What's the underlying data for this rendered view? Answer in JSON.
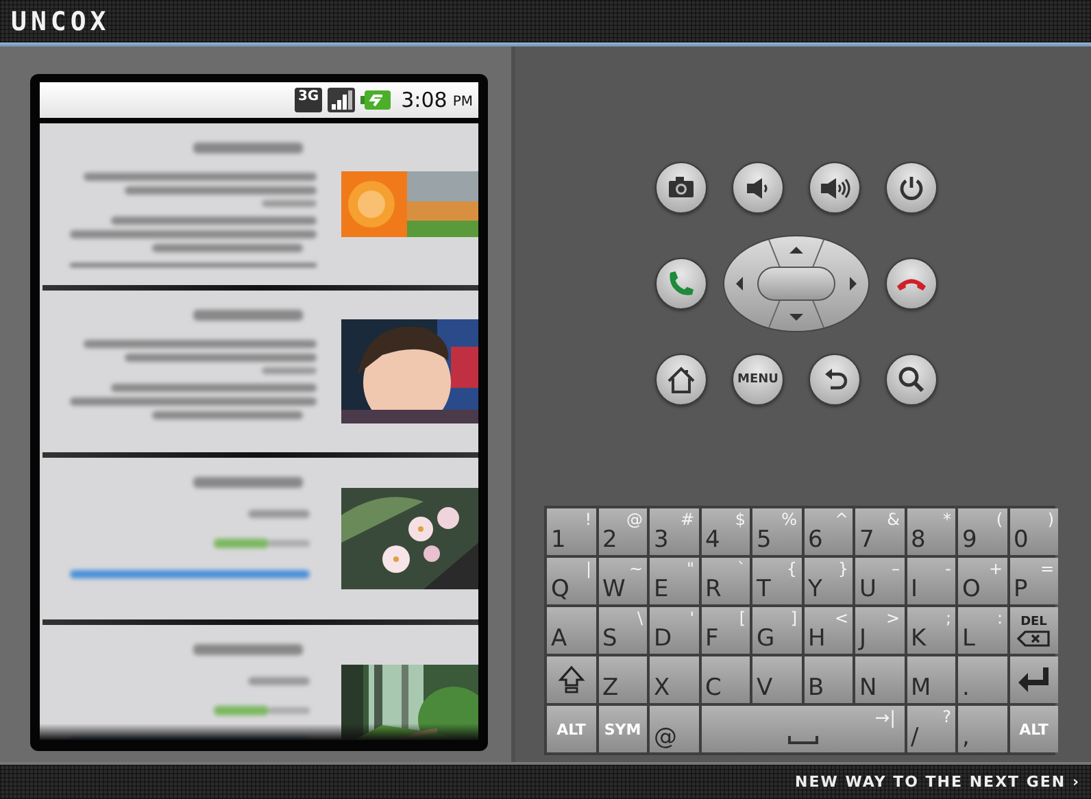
{
  "header": {
    "logo": "UNCOX"
  },
  "phone": {
    "status_bar": {
      "network": "3G",
      "time": "3:08",
      "meridiem": "PM"
    },
    "list_items": [
      {
        "kind": "long"
      },
      {
        "kind": "long"
      },
      {
        "kind": "short"
      },
      {
        "kind": "short"
      }
    ]
  },
  "controls": [
    {
      "kind": "camera"
    },
    {
      "kind": "volume-down"
    },
    {
      "kind": "volume-up"
    },
    {
      "kind": "power"
    },
    {
      "kind": "call"
    },
    {
      "kind": "dpad"
    },
    {
      "kind": "end-call"
    },
    {
      "kind": "home"
    },
    {
      "kind": "menu",
      "label": "MENU"
    },
    {
      "kind": "back"
    },
    {
      "kind": "search"
    }
  ],
  "keyboard": {
    "keys": [
      {
        "kind": "char",
        "main": "1",
        "alt": "!"
      },
      {
        "kind": "char",
        "main": "2",
        "alt": "@"
      },
      {
        "kind": "char",
        "main": "3",
        "alt": "#"
      },
      {
        "kind": "char",
        "main": "4",
        "alt": "$"
      },
      {
        "kind": "char",
        "main": "5",
        "alt": "%"
      },
      {
        "kind": "char",
        "main": "6",
        "alt": "^"
      },
      {
        "kind": "char",
        "main": "7",
        "alt": "&"
      },
      {
        "kind": "char",
        "main": "8",
        "alt": "*"
      },
      {
        "kind": "char",
        "main": "9",
        "alt": "("
      },
      {
        "kind": "char",
        "main": "0",
        "alt": ")"
      },
      {
        "kind": "char",
        "main": "Q",
        "alt": "|"
      },
      {
        "kind": "char",
        "main": "W",
        "alt": "~"
      },
      {
        "kind": "char",
        "main": "E",
        "alt": "\""
      },
      {
        "kind": "char",
        "main": "R",
        "alt": "`"
      },
      {
        "kind": "char",
        "main": "T",
        "alt": "{"
      },
      {
        "kind": "char",
        "main": "Y",
        "alt": "}"
      },
      {
        "kind": "char",
        "main": "U",
        "alt": "–"
      },
      {
        "kind": "char",
        "main": "I",
        "alt": "-"
      },
      {
        "kind": "char",
        "main": "O",
        "alt": "+"
      },
      {
        "kind": "char",
        "main": "P",
        "alt": "="
      },
      {
        "kind": "char",
        "main": "A"
      },
      {
        "kind": "char",
        "main": "S",
        "alt": "\\"
      },
      {
        "kind": "char",
        "main": "D",
        "alt": "'"
      },
      {
        "kind": "char",
        "main": "F",
        "alt": "["
      },
      {
        "kind": "char",
        "main": "G",
        "alt": "]"
      },
      {
        "kind": "char",
        "main": "H",
        "alt": "<"
      },
      {
        "kind": "char",
        "main": "J",
        "alt": ">"
      },
      {
        "kind": "char",
        "main": "K",
        "alt": ";"
      },
      {
        "kind": "char",
        "main": "L",
        "alt": ":"
      },
      {
        "kind": "del",
        "main": "DEL"
      },
      {
        "kind": "shift"
      },
      {
        "kind": "char",
        "main": "Z"
      },
      {
        "kind": "char",
        "main": "X"
      },
      {
        "kind": "char",
        "main": "C"
      },
      {
        "kind": "char",
        "main": "V"
      },
      {
        "kind": "char",
        "main": "B"
      },
      {
        "kind": "char",
        "main": "N"
      },
      {
        "kind": "char",
        "main": "M"
      },
      {
        "kind": "char",
        "main": "."
      },
      {
        "kind": "enter"
      },
      {
        "kind": "mod",
        "main": "ALT"
      },
      {
        "kind": "mod",
        "main": "SYM"
      },
      {
        "kind": "char",
        "main": "@"
      },
      {
        "kind": "space",
        "alt": "→|"
      },
      {
        "kind": "char",
        "main": "/",
        "alt": "?"
      },
      {
        "kind": "char",
        "main": ","
      },
      {
        "kind": "mod",
        "main": "ALT"
      }
    ]
  },
  "footer": {
    "tagline": "NEW WAY TO THE NEXT GEN ›"
  }
}
